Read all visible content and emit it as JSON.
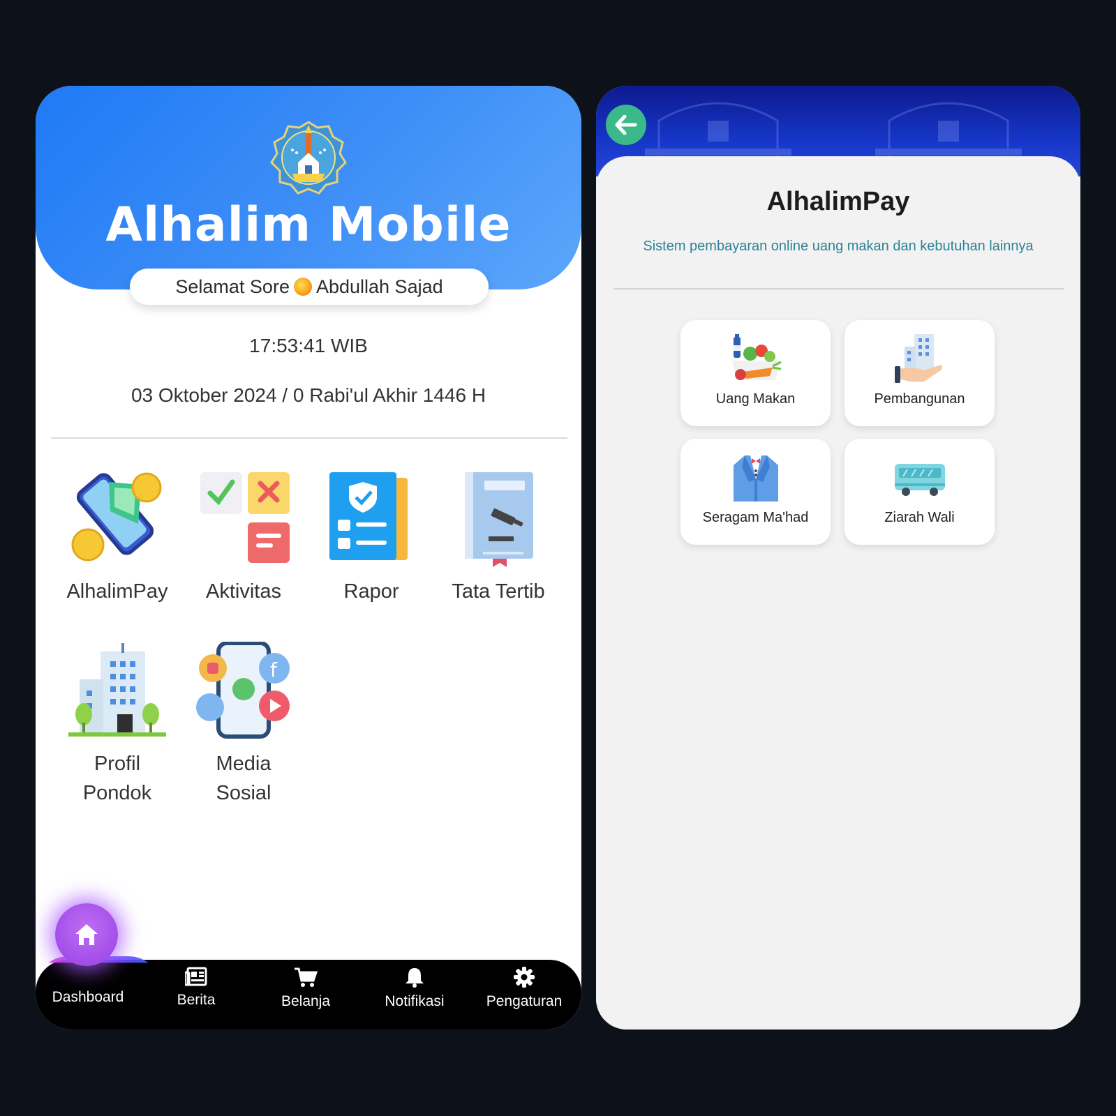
{
  "left_app": {
    "title": "Alhalim Mobile",
    "greeting_prefix": "Selamat Sore",
    "greeting_name": "Abdullah Sajad",
    "time": "17:53:41 WIB",
    "date": "03 Oktober 2024 / 0 Rabi'ul Akhir 1446 H",
    "menu": [
      {
        "label": "AlhalimPay",
        "icon": "wallet-phone-icon"
      },
      {
        "label": "Aktivitas",
        "icon": "activity-notes-icon"
      },
      {
        "label": "Rapor",
        "icon": "report-card-icon"
      },
      {
        "label": "Tata Tertib",
        "icon": "rule-book-icon"
      },
      {
        "label": "Profil Pondok",
        "icon": "building-icon"
      },
      {
        "label": "Media Sosial",
        "icon": "social-media-icon"
      }
    ],
    "nav": [
      {
        "label": "Dashboard",
        "icon": "home-icon"
      },
      {
        "label": "Berita",
        "icon": "newspaper-icon"
      },
      {
        "label": "Belanja",
        "icon": "cart-icon"
      },
      {
        "label": "Notifikasi",
        "icon": "bell-icon"
      },
      {
        "label": "Pengaturan",
        "icon": "gear-icon"
      }
    ]
  },
  "right_app": {
    "title": "AlhalimPay",
    "subtitle": "Sistem pembayaran online uang makan dan kebutuhan lainnya",
    "items": [
      {
        "label": "Uang Makan",
        "icon": "groceries-icon"
      },
      {
        "label": "Pembangunan",
        "icon": "building-hand-icon"
      },
      {
        "label": "Seragam Ma'had",
        "icon": "suit-icon"
      },
      {
        "label": "Ziarah Wali",
        "icon": "bus-icon"
      }
    ]
  },
  "colors": {
    "hero_blue": "#2f85f6",
    "back_button": "#3cb98a",
    "fab_purple": "#a24ee9",
    "subtitle_teal": "#2e8296"
  }
}
